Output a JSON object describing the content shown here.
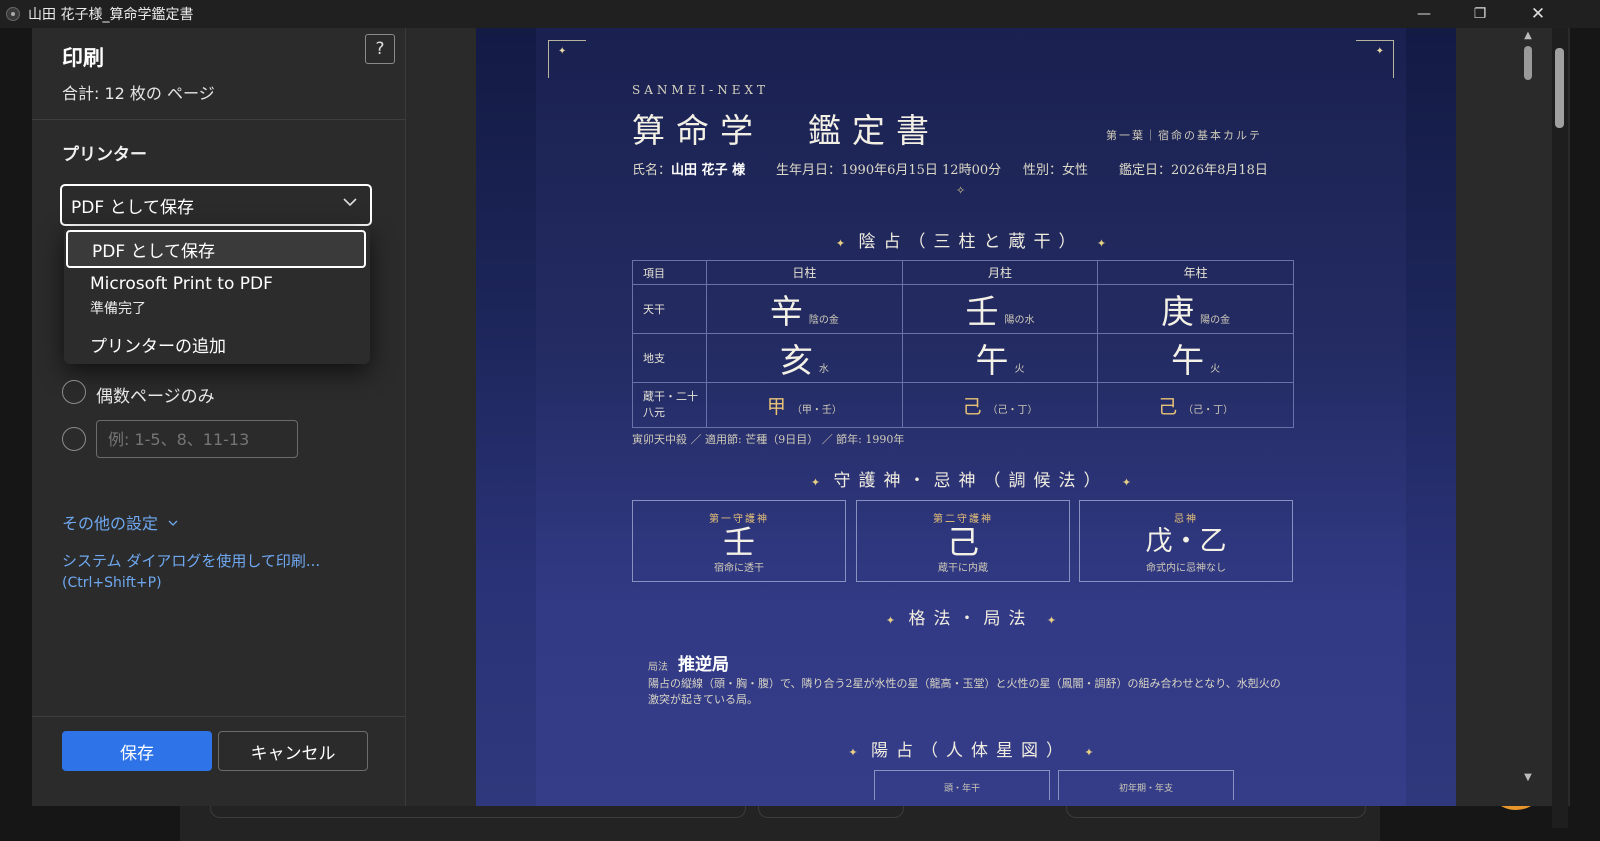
{
  "window": {
    "title": "山田 花子様_算命学鑑定書",
    "minimize_glyph": "—",
    "restore_glyph": "❐",
    "close_glyph": "✕"
  },
  "print_panel": {
    "title": "印刷",
    "page_count": "合計: 12 枚の ページ",
    "help_glyph": "?",
    "printer_label": "プリンター",
    "printer_selected": "PDF として保存",
    "dropdown_options": [
      {
        "label": "PDF として保存"
      },
      {
        "label": "Microsoft Print to PDF",
        "note": "準備完了"
      },
      {
        "label": "プリンターの追加"
      }
    ],
    "even_pages_label": "偶数ページのみ",
    "custom_range_placeholder": "例: 1-5、8、11-13",
    "more_settings": "その他の設定",
    "system_dialog": "システム ダイアログを使用して印刷...",
    "system_dialog_shortcut": "(Ctrl+Shift+P)",
    "save_button": "保存",
    "cancel_button": "キャンセル"
  },
  "document": {
    "brand": "SANMEI-NEXT",
    "title": "算命学　鑑定書",
    "subtitle": "第一葉｜宿命の基本カルテ",
    "name_label": "氏名：",
    "name_value": "山田 花子 様",
    "birth": "生年月日：1990年6月15日 12時00分",
    "gender": "性別：女性",
    "appraisal_date": "鑑定日：2026年8月18日",
    "divider_glyph": "✧",
    "star_glyph": "✦",
    "section1": "陰占（三柱と蔵干）",
    "table_headers": [
      "項目",
      "日柱",
      "月柱",
      "年柱"
    ],
    "row_tenkan": {
      "label": "天干",
      "cells": [
        {
          "char": "辛",
          "note": "陰の金"
        },
        {
          "char": "壬",
          "note": "陽の水"
        },
        {
          "char": "庚",
          "note": "陽の金"
        }
      ]
    },
    "row_chishi": {
      "label": "地支",
      "cells": [
        {
          "char": "亥",
          "note": "水"
        },
        {
          "char": "午",
          "note": "火"
        },
        {
          "char": "午",
          "note": "火"
        }
      ]
    },
    "row_zoukan": {
      "label": "蔵干・二十八元",
      "cells": [
        {
          "char": "甲",
          "note": "（甲・壬）"
        },
        {
          "char": "己",
          "note": "（己・丁）"
        },
        {
          "char": "己",
          "note": "（己・丁）"
        }
      ]
    },
    "table_note": "寅卯天中殺 ／ 適用節: 芒種（9日目） ／ 節年: 1990年",
    "section2": "守護神・忌神（調候法）",
    "cards": [
      {
        "title": "第一守護神",
        "char": "壬",
        "note": "宿命に透干"
      },
      {
        "title": "第二守護神",
        "char": "己",
        "note": "蔵干に内蔵"
      },
      {
        "title": "忌神",
        "char": "戊・乙",
        "note": "命式内に忌神なし"
      }
    ],
    "section3": "格法・局法",
    "kyoku_label": "局法",
    "kyoku_value": "推逆局",
    "kyoku_desc": "陽占の縦線（頭・胸・腹）で、隣り合う2星が水性の星（龍高・玉堂）と火性の星（鳳閣・調舒）の組み合わせとなり、水剋火の激突が起きている局。",
    "section4": "陽占（人体星図）",
    "body_boxes": [
      "頭・年干",
      "初年期・年支"
    ]
  },
  "scroll": {
    "up_glyph": "▲",
    "down_glyph": "▼"
  }
}
